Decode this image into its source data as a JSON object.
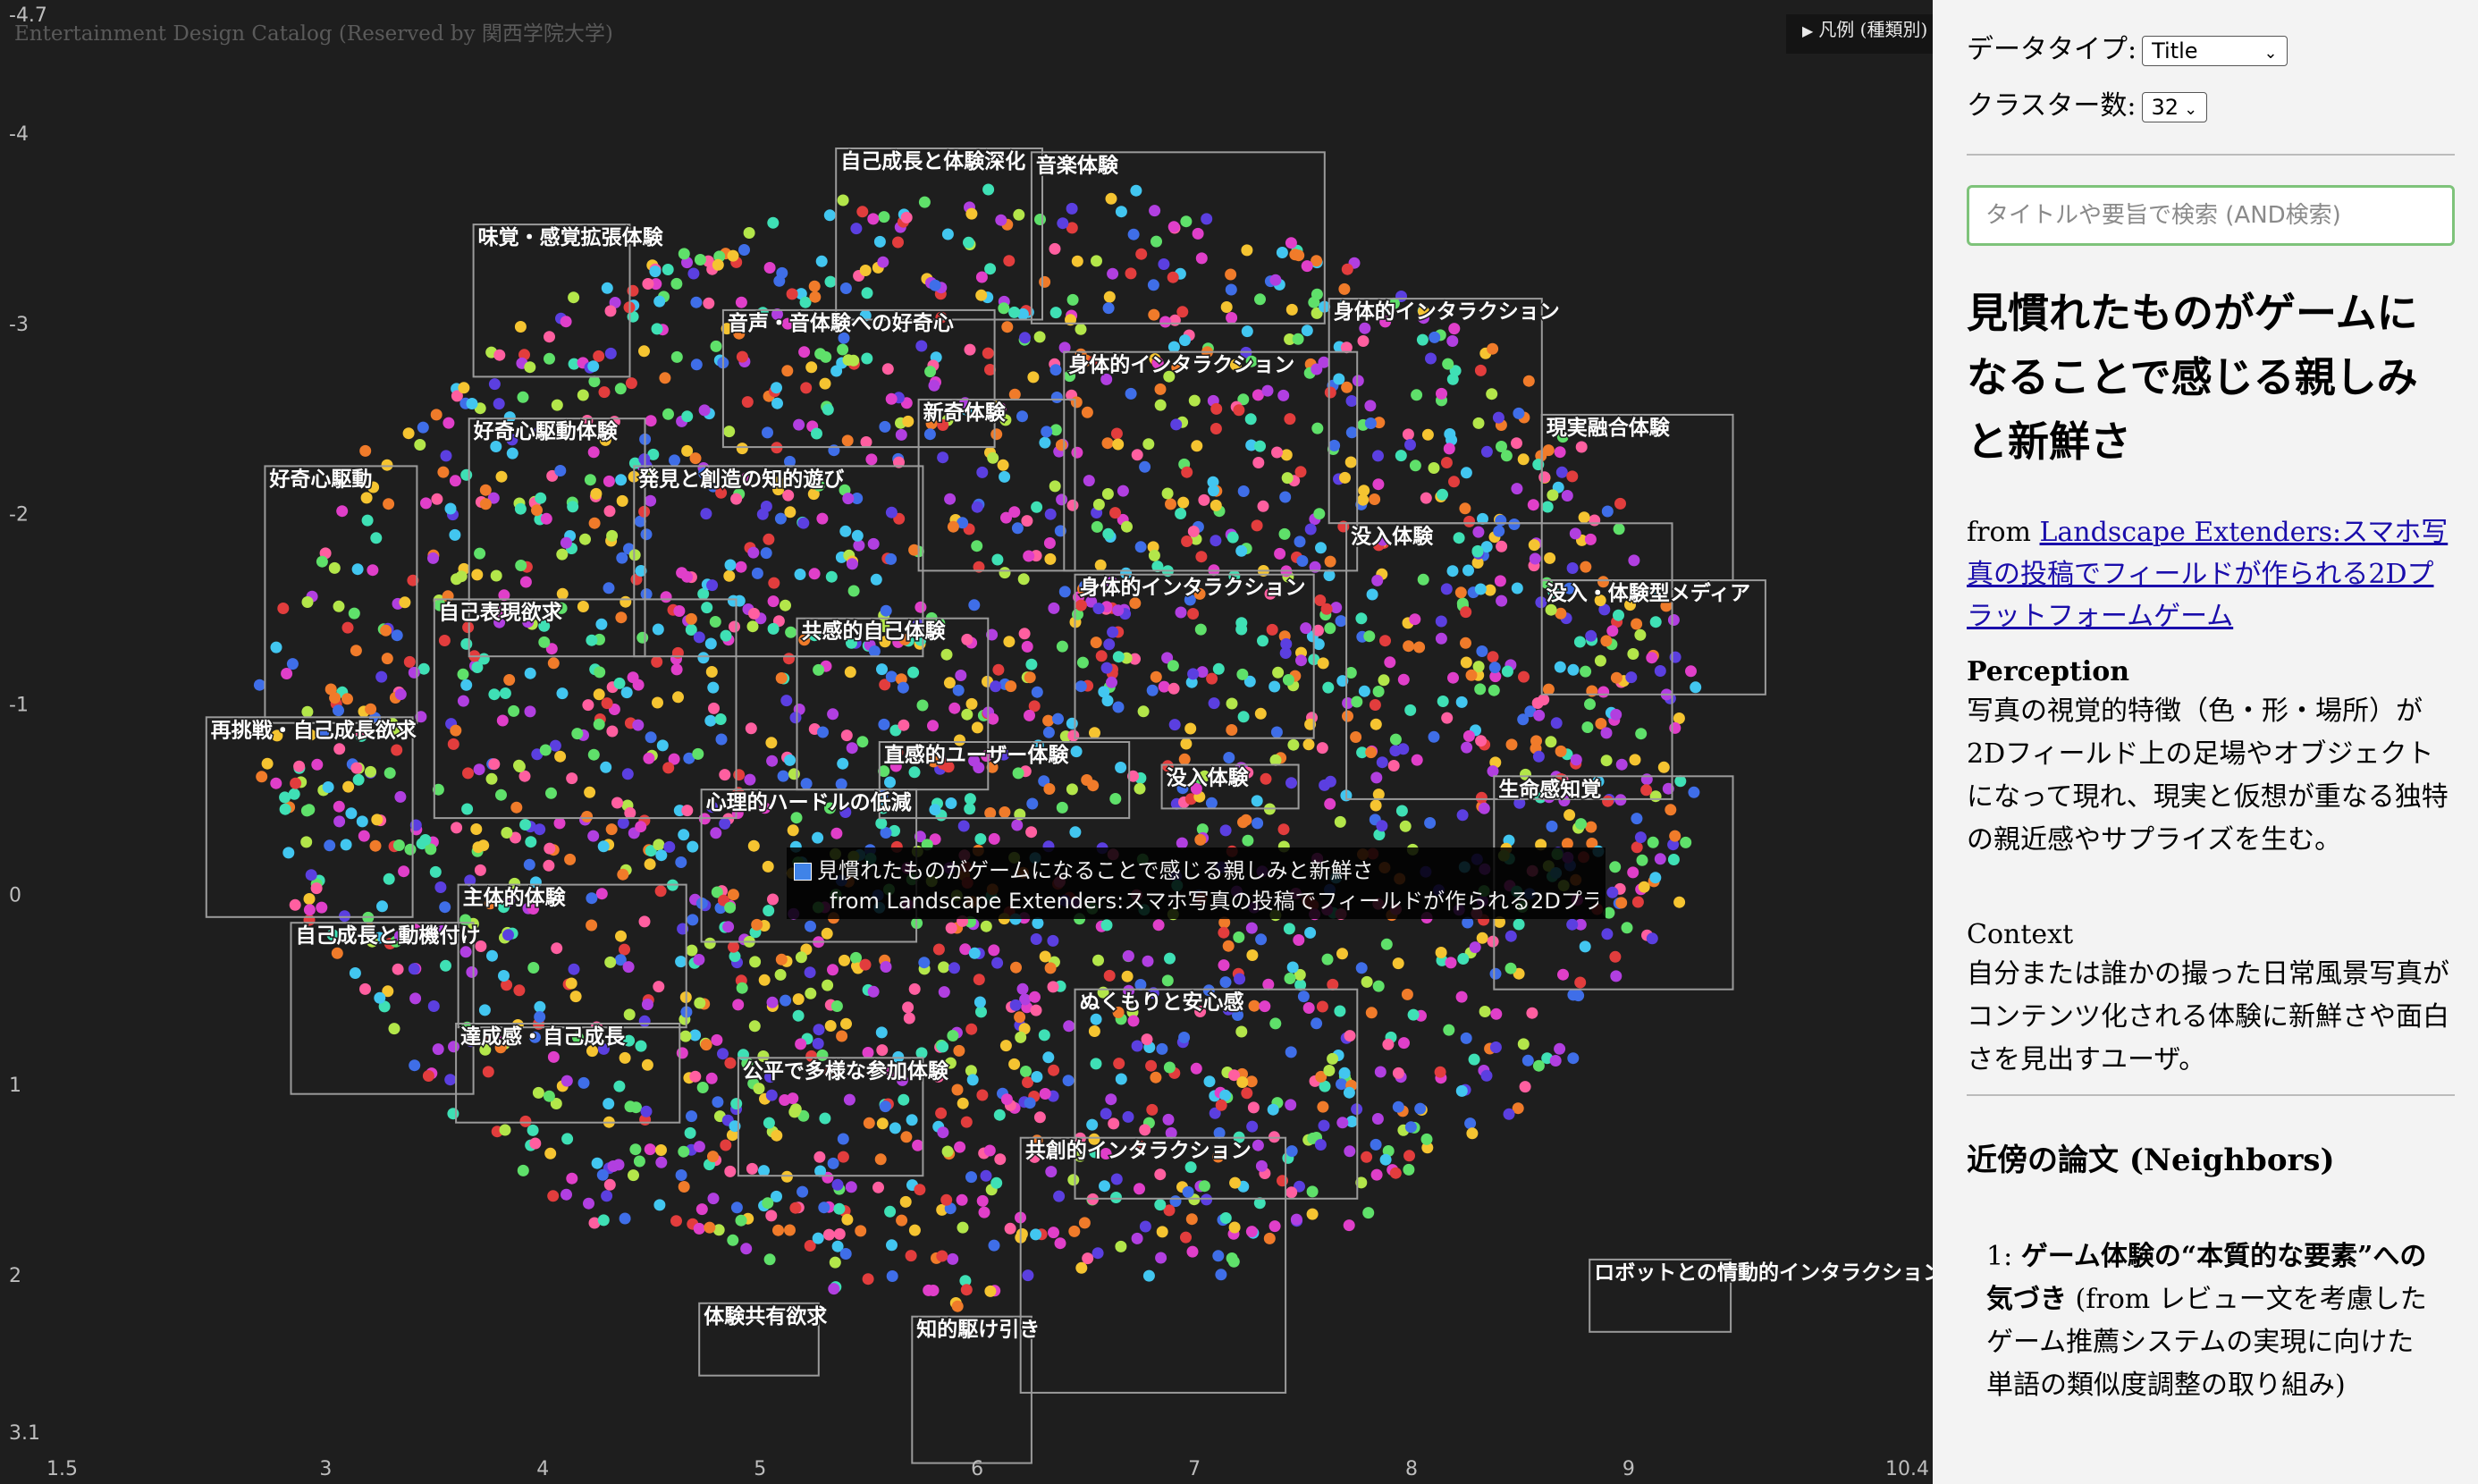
{
  "plot": {
    "watermark": "Entertainment Design Catalog (Reserved by 関西学院大学)",
    "legend_label": "凡例 (種類別)",
    "legend_icon": "triangle-right-icon",
    "axes": {
      "x_range": [
        1.5,
        10.4
      ],
      "y_range": [
        -4.7,
        3.1
      ],
      "x_ticks": [
        "1.5",
        "3",
        "4",
        "5",
        "6",
        "7",
        "8",
        "9",
        "10.4"
      ],
      "y_ticks": [
        "-4.7",
        "-4",
        "-3",
        "-2",
        "-1",
        "0",
        "1",
        "2",
        "3.1"
      ]
    },
    "clusters": [
      {
        "label": "自己成長と体験深化",
        "x0": 5.35,
        "x1": 6.3,
        "y0": -3.92,
        "y1": -3.02
      },
      {
        "label": "音楽体験",
        "x0": 6.25,
        "x1": 7.6,
        "y0": -3.9,
        "y1": -3.0
      },
      {
        "label": "味覚・感覚拡張体験",
        "x0": 3.68,
        "x1": 4.4,
        "y0": -3.52,
        "y1": -2.72
      },
      {
        "label": "音声・音体験への好奇心",
        "x0": 4.83,
        "x1": 6.08,
        "y0": -3.07,
        "y1": -2.35
      },
      {
        "label": "身体的インタラクション",
        "x0": 7.62,
        "x1": 8.6,
        "y0": -3.13,
        "y1": -1.95
      },
      {
        "label": "身体的インタラクション",
        "x0": 6.4,
        "x1": 7.75,
        "y0": -2.85,
        "y1": -1.7
      },
      {
        "label": "新奇体験",
        "x0": 5.73,
        "x1": 6.45,
        "y0": -2.6,
        "y1": -1.7
      },
      {
        "label": "好奇心駆動体験",
        "x0": 3.66,
        "x1": 4.47,
        "y0": -2.5,
        "y1": -1.25
      },
      {
        "label": "発見と創造の知的遊び",
        "x0": 4.42,
        "x1": 5.75,
        "y0": -2.25,
        "y1": -1.25
      },
      {
        "label": "現実融合体験",
        "x0": 8.6,
        "x1": 9.48,
        "y0": -2.52,
        "y1": -1.65
      },
      {
        "label": "好奇心駆動",
        "x0": 2.72,
        "x1": 3.42,
        "y0": -2.25,
        "y1": -0.9
      },
      {
        "label": "没入体験",
        "x0": 7.7,
        "x1": 9.2,
        "y0": -1.95,
        "y1": -0.5
      },
      {
        "label": "身体的インタラクション",
        "x0": 6.45,
        "x1": 7.55,
        "y0": -1.68,
        "y1": -0.82
      },
      {
        "label": "没入・体験型メディア",
        "x0": 8.6,
        "x1": 9.63,
        "y0": -1.65,
        "y1": -1.05
      },
      {
        "label": "自己表現欲求",
        "x0": 3.5,
        "x1": 4.89,
        "y0": -1.55,
        "y1": -0.4
      },
      {
        "label": "共感的自己体験",
        "x0": 5.17,
        "x1": 6.05,
        "y0": -1.45,
        "y1": -0.55
      },
      {
        "label": "再挑戦・自己成長欲求",
        "x0": 2.45,
        "x1": 3.4,
        "y0": -0.93,
        "y1": 0.12
      },
      {
        "label": "直感的ユーザー体験",
        "x0": 5.55,
        "x1": 6.7,
        "y0": -0.8,
        "y1": -0.4
      },
      {
        "label": "没入体験",
        "x0": 6.85,
        "x1": 7.48,
        "y0": -0.68,
        "y1": -0.45
      },
      {
        "label": "心理的ハードルの低減",
        "x0": 4.73,
        "x1": 5.72,
        "y0": -0.55,
        "y1": 0.25
      },
      {
        "label": "生命感知覚",
        "x0": 8.38,
        "x1": 9.48,
        "y0": -0.62,
        "y1": 0.5
      },
      {
        "label": "主体的体験",
        "x0": 3.61,
        "x1": 4.66,
        "y0": -0.05,
        "y1": 0.7
      },
      {
        "label": "自己成長と動機付け",
        "x0": 2.84,
        "x1": 3.68,
        "y0": 0.15,
        "y1": 1.05
      },
      {
        "label": "ぬくもりと安心感",
        "x0": 6.45,
        "x1": 7.75,
        "y0": 0.5,
        "y1": 1.6
      },
      {
        "label": "達成感・自己成長",
        "x0": 3.6,
        "x1": 4.63,
        "y0": 0.68,
        "y1": 1.2
      },
      {
        "label": "公平で多様な参加体験",
        "x0": 4.9,
        "x1": 5.75,
        "y0": 0.86,
        "y1": 1.48
      },
      {
        "label": "共創的インタラクション",
        "x0": 6.2,
        "x1": 7.42,
        "y0": 1.28,
        "y1": 2.62
      },
      {
        "label": "ロボットとの情動的インタラクション",
        "x0": 8.82,
        "x1": 9.47,
        "y0": 1.92,
        "y1": 2.3
      },
      {
        "label": "体験共有欲求",
        "x0": 4.72,
        "x1": 5.27,
        "y0": 2.15,
        "y1": 2.53
      },
      {
        "label": "知的駆け引き",
        "x0": 5.7,
        "x1": 6.25,
        "y0": 2.22,
        "y1": 2.99
      }
    ]
  },
  "tooltip": {
    "color": "#3f83e8",
    "title": "見慣れたものがゲームになることで感じる親しみと新鮮さ",
    "from": "from Landscape Extenders:スマホ写真の投稿でフィールドが作られる2Dプラッ..."
  },
  "sidebar": {
    "data_type_label": "データタイプ:",
    "data_type_value": "Title",
    "cluster_count_label": "クラスター数:",
    "cluster_count_value": "32",
    "search_placeholder": "タイトルや要旨で検索 (AND検索)",
    "title": "見慣れたものがゲームになることで感じる親しみと新鮮さ",
    "from_prefix": "from",
    "from_link": "Landscape Extenders:スマホ写真の投稿でフィールドが作られる2Dプラットフォームゲーム",
    "perception_heading": "Perception",
    "perception_text": "写真の視覚的特徴（色・形・場所）が2Dフィールド上の足場やオブジェクトになって現れ、現実と仮想が重なる独特の親近感やサプライズを生む。",
    "context_heading": "Context",
    "context_text": "自分または誰かの撮った日常風景写真がコンテンツ化される体験に新鮮さや面白さを見出すユーザ。",
    "neighbors_heading": "近傍の論文 (Neighbors)",
    "neighbor_1_num": "1:",
    "neighbor_1_title": "ゲーム体験の“本質的な要素”への気づき",
    "neighbor_1_from": "(from レビュー文を考慮したゲーム推薦システムの実現に向けた単語の類似度調整の取り組み)"
  }
}
